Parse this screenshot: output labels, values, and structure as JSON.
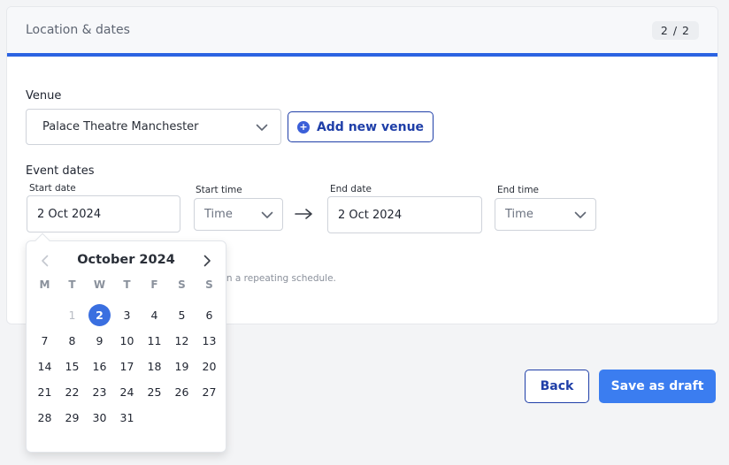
{
  "card": {
    "title": "Location & dates",
    "step": "2 / 2"
  },
  "venue": {
    "label": "Venue",
    "selected": "Palace Theatre Manchester",
    "add_button": "Add new venue"
  },
  "event_dates": {
    "label": "Event dates",
    "start_date_label": "Start date",
    "start_date_value": "2 Oct 2024",
    "start_time_label": "Start time",
    "start_time_placeholder": "Time",
    "end_date_label": "End date",
    "end_date_value": "2 Oct 2024",
    "end_time_label": "End time",
    "end_time_placeholder": "Time",
    "hint_fragment": "in a repeating schedule."
  },
  "datepicker": {
    "month": "October 2024",
    "weekdays": [
      "M",
      "T",
      "W",
      "T",
      "F",
      "S",
      "S"
    ],
    "leading_muted": [
      "1"
    ],
    "selected_day": "2",
    "days": [
      "1",
      "2",
      "3",
      "4",
      "5",
      "6",
      "7",
      "8",
      "9",
      "10",
      "11",
      "12",
      "13",
      "14",
      "15",
      "16",
      "17",
      "18",
      "19",
      "20",
      "21",
      "22",
      "23",
      "24",
      "25",
      "26",
      "27",
      "28",
      "29",
      "30",
      "31"
    ],
    "start_offset": 1
  },
  "footer": {
    "back": "Back",
    "save_draft": "Save as draft"
  },
  "colors": {
    "accent": "#2b63e2",
    "primary_button": "#3b7df0",
    "outline": "#1f3fa8",
    "selected_day": "#3a6fe0"
  }
}
